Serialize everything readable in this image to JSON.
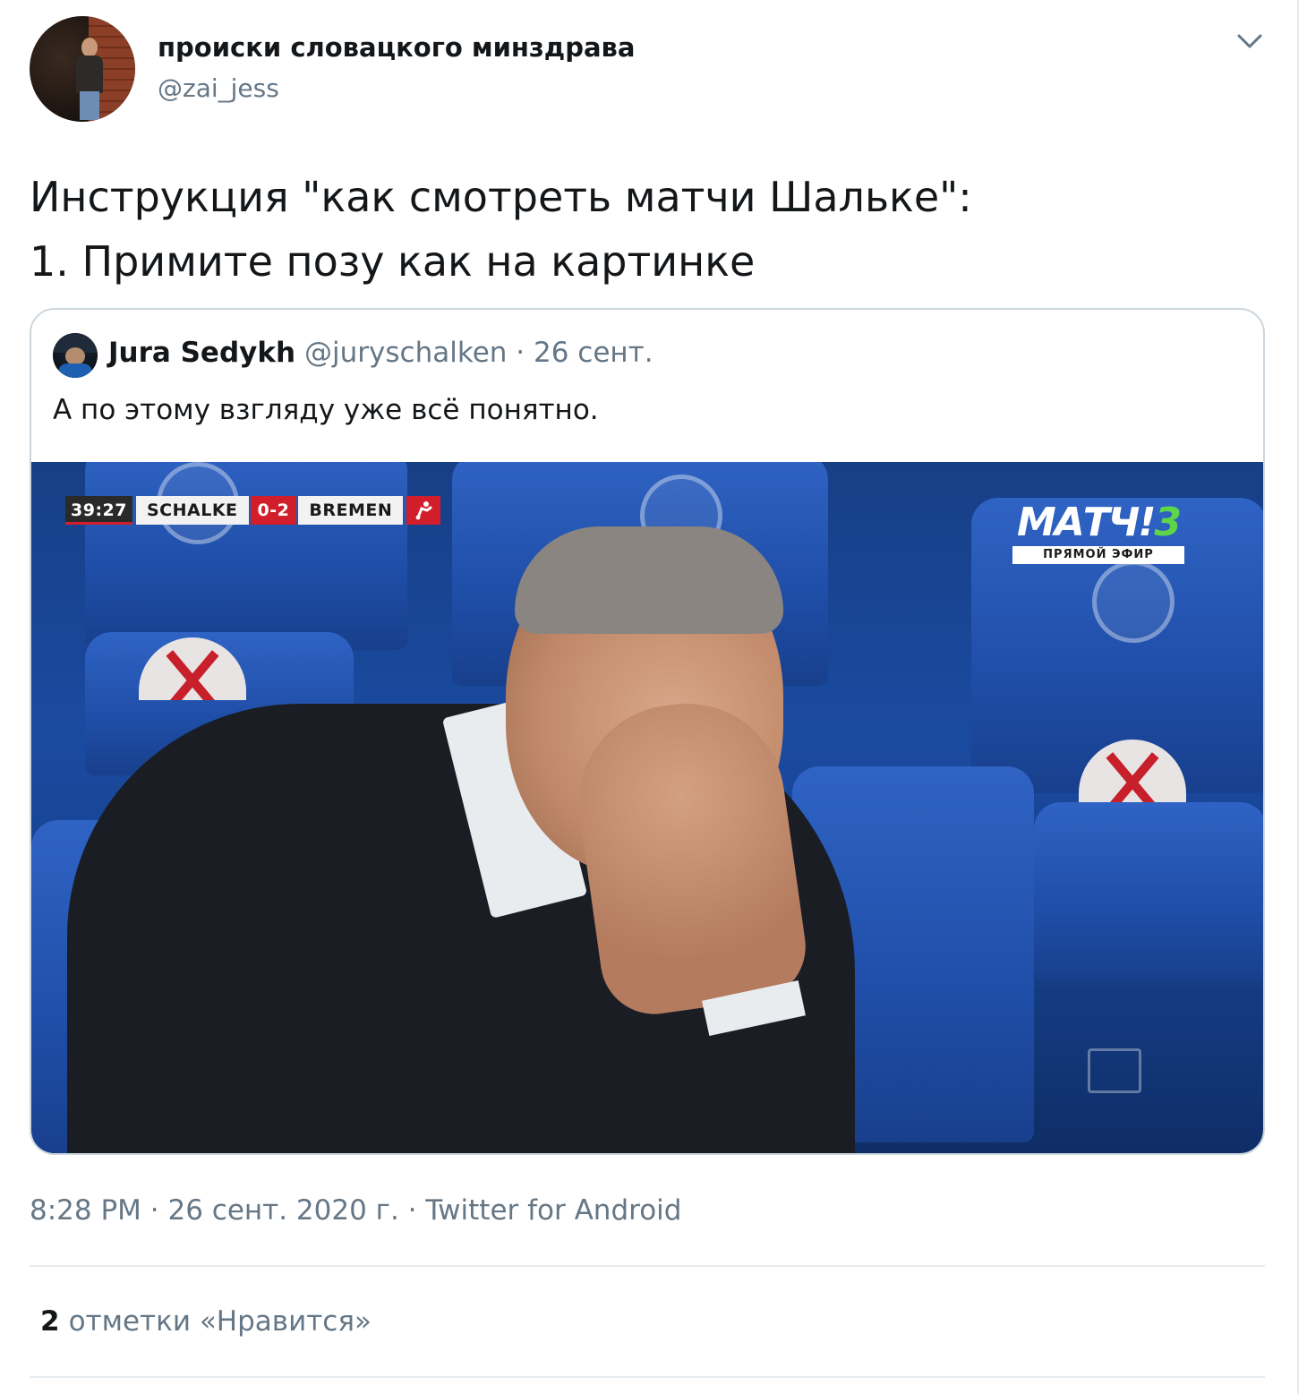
{
  "author": {
    "display_name": "происки словацкого минздрава",
    "handle": "@zai_jess"
  },
  "tweet": {
    "lines": [
      "Инструкция \"как смотреть матчи Шальке\":",
      "1. Примите позу как на картинке"
    ]
  },
  "quoted_tweet": {
    "display_name": "Jura Sedykh",
    "meta": "@juryschalken · 26 сент.",
    "text": "А по этому взгляду уже всё понятно.",
    "media": {
      "scorebug": {
        "clock": "39:27",
        "home_team": "SCHALKE",
        "score": "0-2",
        "away_team": "BREMEN"
      },
      "broadcaster": {
        "logo_text": "МАТЧ!",
        "channel_number": "3",
        "live_label": "ПРЯМОЙ ЭФИР"
      }
    }
  },
  "footer": {
    "timestamp": "8:28 PM · 26 сент. 2020 г. · Twitter for Android",
    "likes_count": "2",
    "likes_label": "отметки «Нравится»"
  },
  "colors": {
    "text_primary": "#14171a",
    "text_secondary": "#657786",
    "border": "#ccd6dd",
    "divider": "#e6ecf0",
    "bundesliga_red": "#d21e2b",
    "match_green": "#5fd64a"
  }
}
